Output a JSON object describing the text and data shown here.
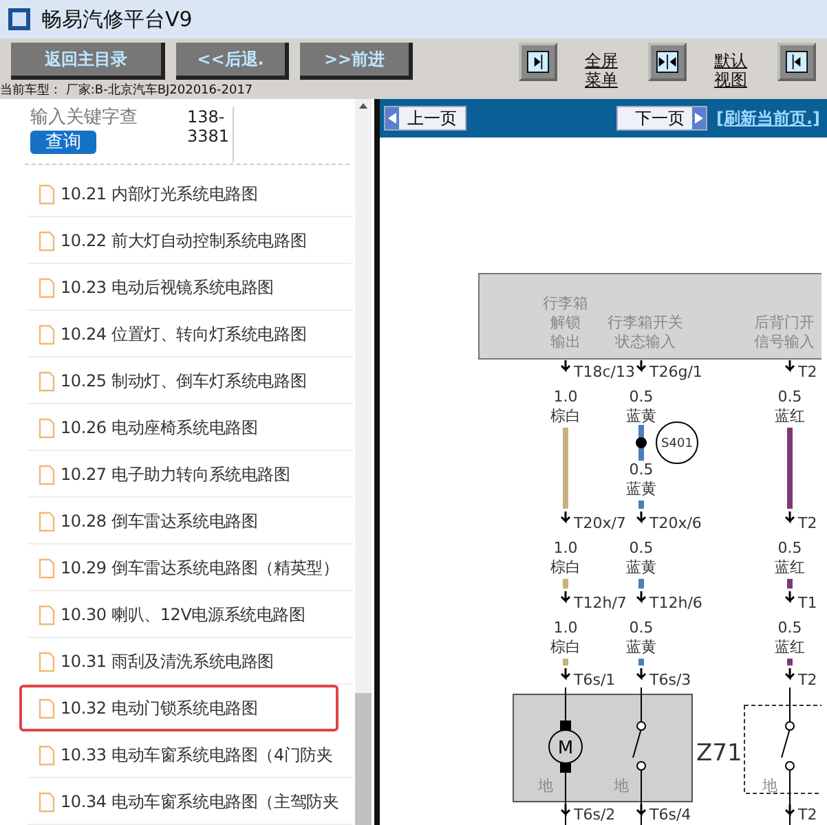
{
  "window": {
    "title": "畅易汽修平台V9"
  },
  "toolbar": {
    "buttons": [
      "返回主目录",
      "<<后退.",
      ">>前进"
    ],
    "view_controls": [
      {
        "kind": "right",
        "label": "全屏菜单"
      },
      {
        "kind": "both",
        "label": "默认视图"
      },
      {
        "kind": "left"
      }
    ]
  },
  "current_model": "当前车型：  厂家:B-北京汽车BJ202016-2017",
  "search": {
    "placeholder": "输入关键字查",
    "phone": "138-3381",
    "button": "查询"
  },
  "sidebar": {
    "items": [
      {
        "label": "10.21 内部灯光系统电路图",
        "selected": false
      },
      {
        "label": "10.22 前大灯自动控制系统电路图",
        "selected": false
      },
      {
        "label": "10.23 电动后视镜系统电路图",
        "selected": false
      },
      {
        "label": "10.24 位置灯、转向灯系统电路图",
        "selected": false
      },
      {
        "label": "10.25 制动灯、倒车灯系统电路图",
        "selected": false
      },
      {
        "label": "10.26 电动座椅系统电路图",
        "selected": false
      },
      {
        "label": "10.27 电子助力转向系统电路图",
        "selected": false
      },
      {
        "label": "10.28 倒车雷达系统电路图",
        "selected": false
      },
      {
        "label": "10.29 倒车雷达系统电路图（精英型）",
        "selected": false
      },
      {
        "label": "10.30 喇叭、12V电源系统电路图",
        "selected": false
      },
      {
        "label": "10.31 雨刮及清洗系统电路图",
        "selected": false
      },
      {
        "label": "10.32 电动门锁系统电路图",
        "selected": true
      },
      {
        "label": "10.33 电动车窗系统电路图（4门防夹",
        "selected": false
      },
      {
        "label": "10.34 电动车窗系统电路图（主驾防夹",
        "selected": false
      }
    ]
  },
  "viewer": {
    "prev": "上一页",
    "next": "下一页",
    "refresh": "[刷新当前页.]"
  },
  "diagram": {
    "module_labels": [
      [
        "行李箱",
        "解锁",
        "输出"
      ],
      [
        "行李箱开关",
        "状态输入"
      ],
      [
        "后背门开",
        "信号输入"
      ]
    ],
    "columns": [
      {
        "color": "#c8b27e",
        "spans": [
          {
            "pin": "T18c/13",
            "wires": [
              {
                "size": "1.0",
                "color_name": "棕白"
              }
            ]
          },
          {
            "pin": "T20x/7",
            "wires": [
              {
                "size": "1.0",
                "color_name": "棕白"
              }
            ]
          },
          {
            "pin": "T12h/7",
            "wires": [
              {
                "size": "1.0",
                "color_name": "棕白"
              }
            ]
          },
          {
            "pin": "T6s/1"
          }
        ],
        "kind": "motor",
        "device_label": "M",
        "ground": "地",
        "bottom_pin": "T6s/2"
      },
      {
        "color": "#4a7fb8",
        "spans": [
          {
            "pin": "T26g/1",
            "wires": [
              {
                "size": "0.5",
                "color_name": "蓝黄"
              },
              {
                "size": "0.5",
                "color_name": "蓝黄"
              }
            ],
            "splice": "S401"
          },
          {
            "pin": "T20x/6",
            "wires": [
              {
                "size": "0.5",
                "color_name": "蓝黄"
              }
            ]
          },
          {
            "pin": "T12h/6",
            "wires": [
              {
                "size": "0.5",
                "color_name": "蓝黄"
              }
            ]
          },
          {
            "pin": "T6s/3"
          }
        ],
        "kind": "switch",
        "ground": "地",
        "bottom_pin": "T6s/4"
      },
      {
        "color": "#7a3a78",
        "spans": [
          {
            "pin": "T2",
            "wires": [
              {
                "size": "0.5",
                "color_name": "蓝红"
              }
            ]
          },
          {
            "pin": "T2",
            "wires": [
              {
                "size": "0.5",
                "color_name": "蓝红"
              }
            ]
          },
          {
            "pin": "T1",
            "wires": [
              {
                "size": "0.5",
                "color_name": "蓝红"
              }
            ]
          },
          {
            "pin": "T2"
          }
        ],
        "kind": "switch",
        "ground": "地",
        "bottom_pin": "T2"
      }
    ],
    "component_label": "Z71"
  }
}
